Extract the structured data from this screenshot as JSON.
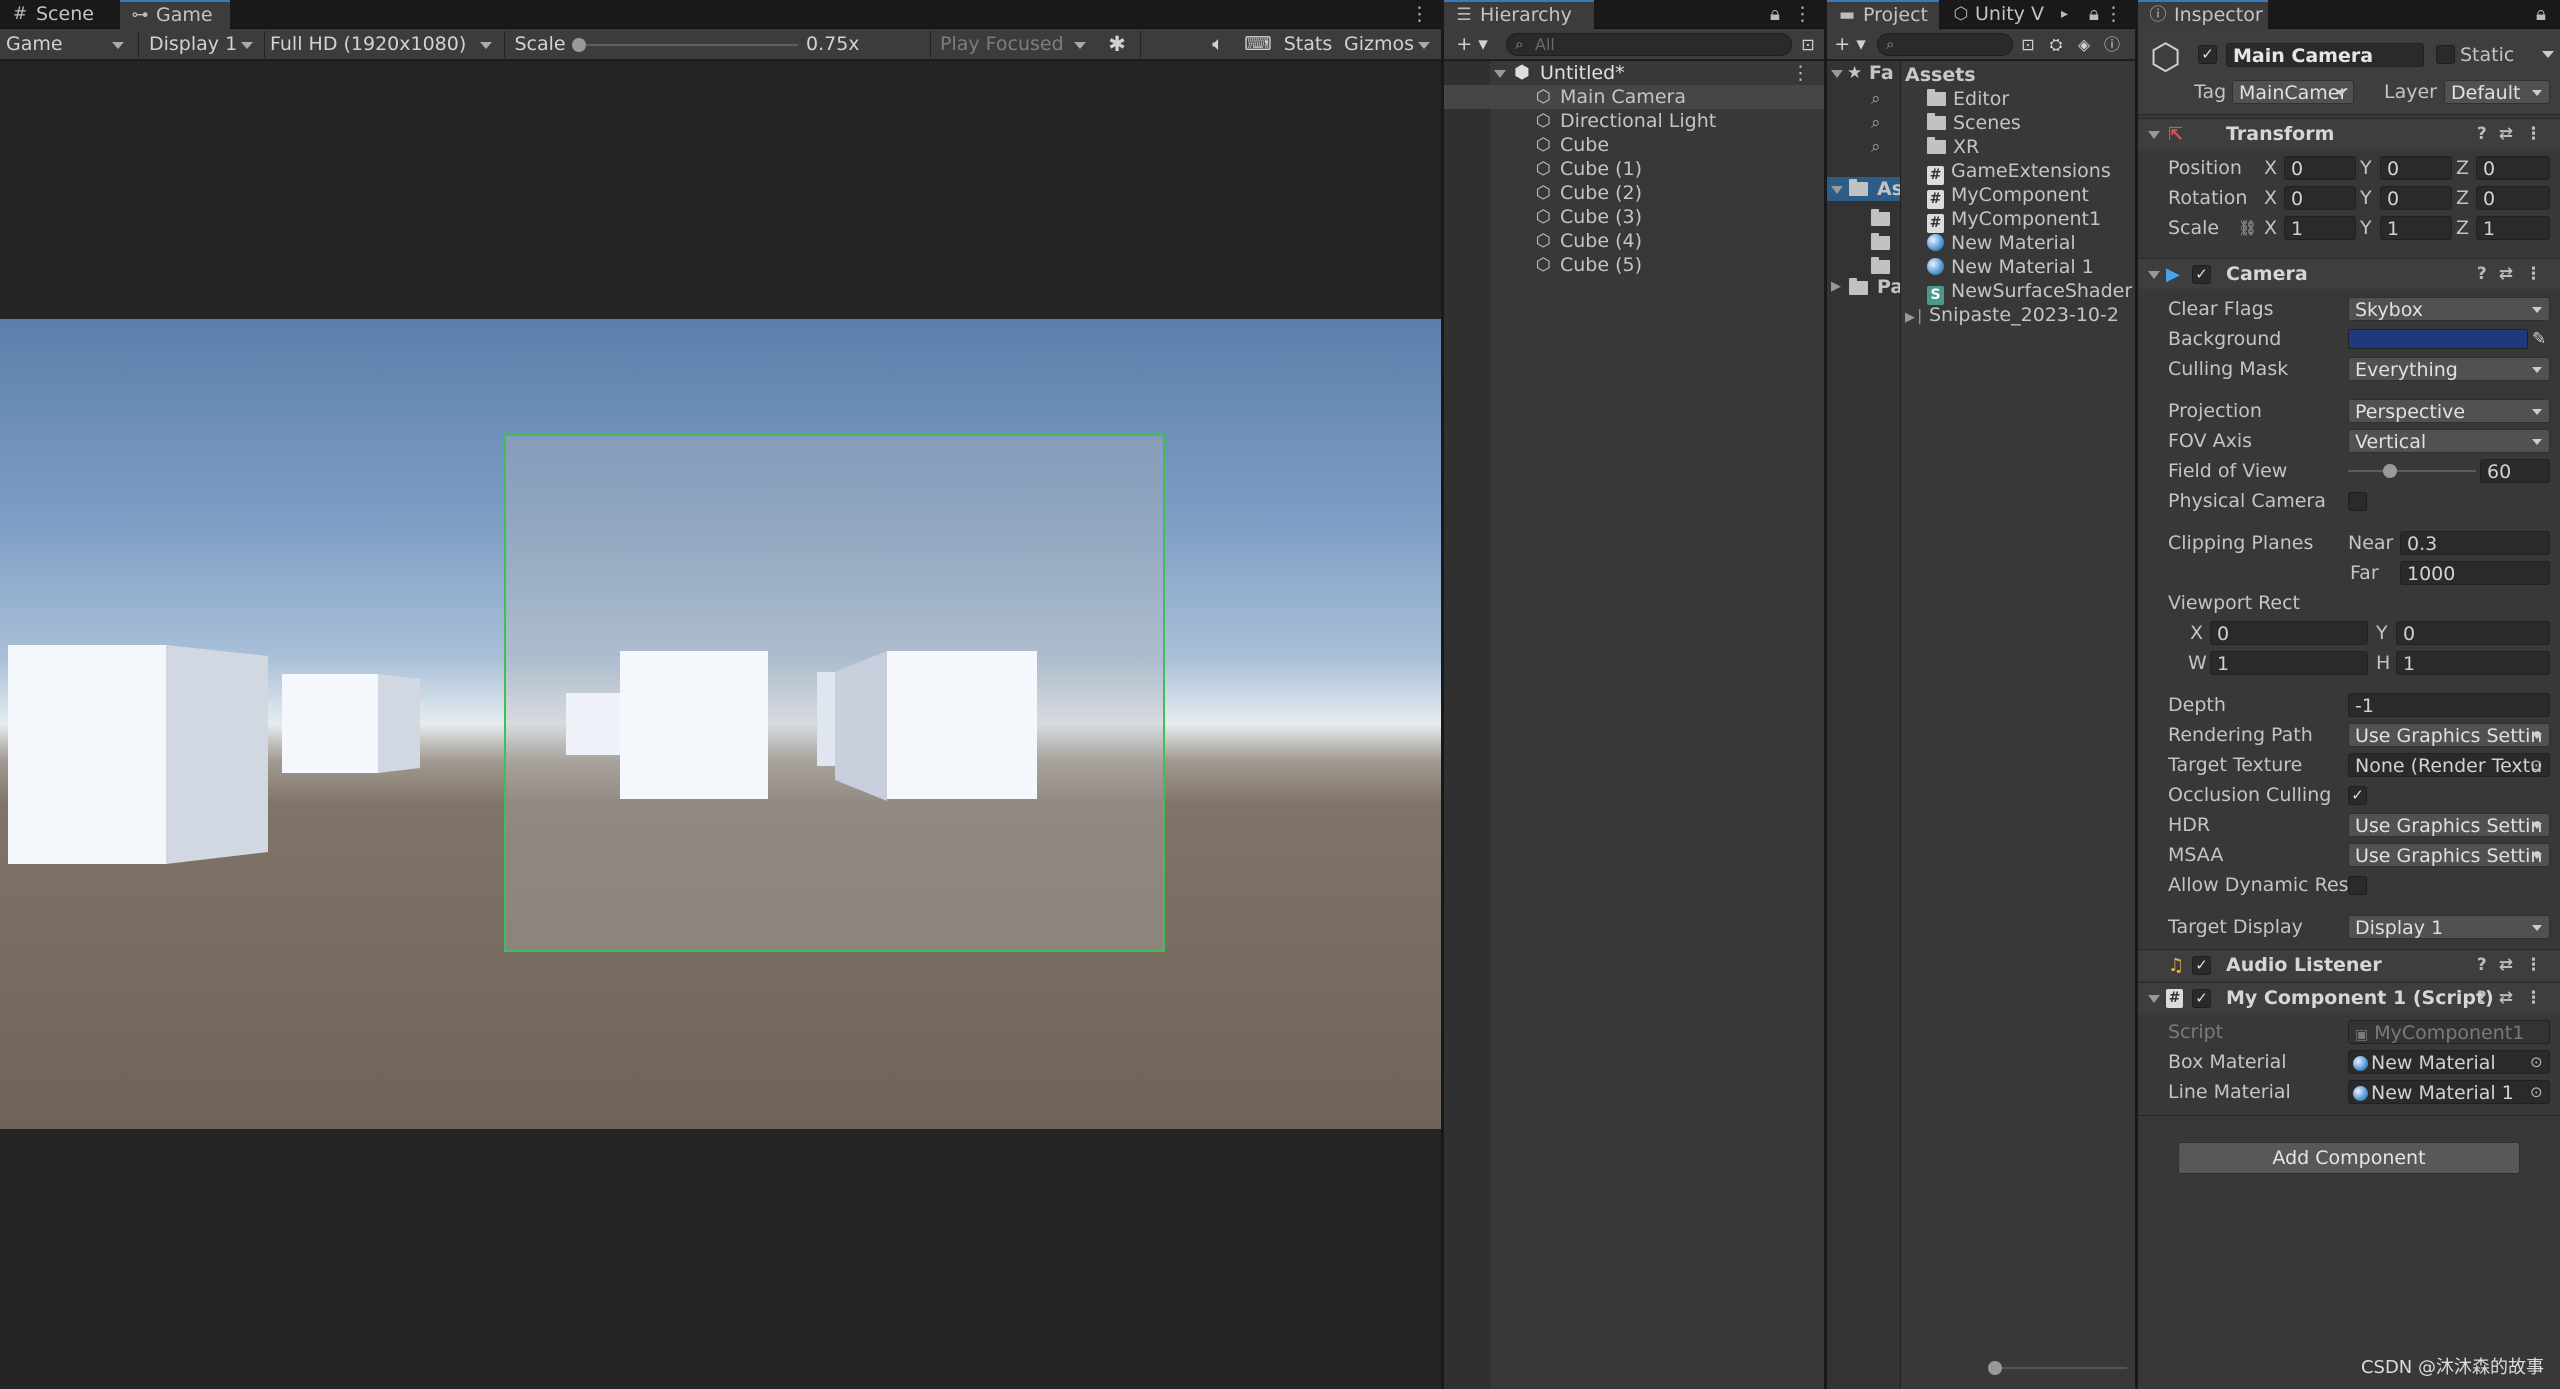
{
  "game_panel": {
    "tabs": [
      {
        "label": "Scene",
        "icon": "grid-icon"
      },
      {
        "label": "Game",
        "icon": "gamepad-icon"
      }
    ],
    "toolbar": {
      "view_mode": "Game",
      "display": "Display 1",
      "resolution": "Full HD (1920x1080)",
      "scale_label": "Scale",
      "scale_value": "0.75x",
      "play_mode": "Play Focused",
      "stats": "Stats",
      "gizmos": "Gizmos"
    }
  },
  "hierarchy": {
    "tab": "Hierarchy",
    "search_placeholder": "All",
    "scene_name": "Untitled*",
    "items": [
      "Main Camera",
      "Directional Light",
      "Cube",
      "Cube (1)",
      "Cube (2)",
      "Cube (3)",
      "Cube (4)",
      "Cube (5)"
    ]
  },
  "project": {
    "tabs": [
      "Project",
      "Unity V"
    ],
    "left_tree": [
      "Fa",
      "As",
      "Pa"
    ],
    "assets_header": "Assets",
    "assets": [
      {
        "name": "Editor",
        "icon": "folder-icon"
      },
      {
        "name": "Scenes",
        "icon": "folder-icon"
      },
      {
        "name": "XR",
        "icon": "folder-icon"
      },
      {
        "name": "GameExtensions",
        "icon": "script-icon"
      },
      {
        "name": "MyComponent",
        "icon": "script-icon"
      },
      {
        "name": "MyComponent1",
        "icon": "script-icon"
      },
      {
        "name": "New Material",
        "icon": "material-icon"
      },
      {
        "name": "New Material 1",
        "icon": "material-icon"
      },
      {
        "name": "NewSurfaceShader",
        "icon": "shader-icon"
      },
      {
        "name": "Snipaste_2023-10-2",
        "icon": "image-icon"
      }
    ]
  },
  "inspector": {
    "tab": "Inspector",
    "object_name": "Main Camera",
    "static_label": "Static",
    "tag_label": "Tag",
    "tag_value": "MainCamer",
    "layer_label": "Layer",
    "layer_value": "Default",
    "transform": {
      "title": "Transform",
      "rows": [
        {
          "label": "Position",
          "x": "0",
          "y": "0",
          "z": "0"
        },
        {
          "label": "Rotation",
          "x": "0",
          "y": "0",
          "z": "0"
        },
        {
          "label": "Scale",
          "x": "1",
          "y": "1",
          "z": "1"
        }
      ]
    },
    "camera": {
      "title": "Camera",
      "clear_flags": {
        "label": "Clear Flags",
        "value": "Skybox"
      },
      "background": {
        "label": "Background",
        "color": "#1f3a7a"
      },
      "culling_mask": {
        "label": "Culling Mask",
        "value": "Everything"
      },
      "projection": {
        "label": "Projection",
        "value": "Perspective"
      },
      "fov_axis": {
        "label": "FOV Axis",
        "value": "Vertical"
      },
      "field_of_view": {
        "label": "Field of View",
        "value": "60",
        "slider_fraction": 0.33
      },
      "physical_camera": {
        "label": "Physical Camera"
      },
      "clipping": {
        "label": "Clipping Planes",
        "near_label": "Near",
        "near": "0.3",
        "far_label": "Far",
        "far": "1000"
      },
      "viewport": {
        "label": "Viewport Rect",
        "x": "0",
        "y": "0",
        "w": "1",
        "h": "1"
      },
      "depth": {
        "label": "Depth",
        "value": "-1"
      },
      "rendering_path": {
        "label": "Rendering Path",
        "value": "Use Graphics Settin"
      },
      "target_texture": {
        "label": "Target Texture",
        "value": "None (Render Textu"
      },
      "occlusion": {
        "label": "Occlusion Culling"
      },
      "hdr": {
        "label": "HDR",
        "value": "Use Graphics Settin"
      },
      "msaa": {
        "label": "MSAA",
        "value": "Use Graphics Settin"
      },
      "dynamic_res": {
        "label": "Allow Dynamic Reso"
      },
      "target_display": {
        "label": "Target Display",
        "value": "Display 1"
      }
    },
    "audio_listener": {
      "title": "Audio Listener"
    },
    "my_component": {
      "title": "My Component 1 (Script)",
      "script": {
        "label": "Script",
        "value": "MyComponent1"
      },
      "box_material": {
        "label": "Box Material",
        "value": "New Material"
      },
      "line_material": {
        "label": "Line Material",
        "value": "New Material 1"
      }
    },
    "add_component": "Add Component"
  },
  "watermark": "CSDN @沐沐森的故事"
}
